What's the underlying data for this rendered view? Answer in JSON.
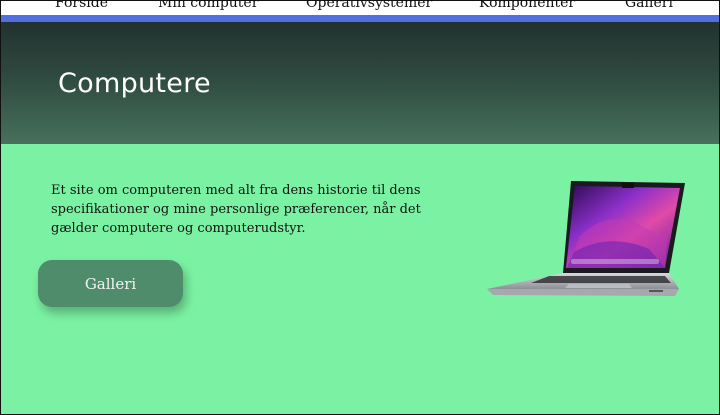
{
  "nav": {
    "items": [
      {
        "label": "Forside"
      },
      {
        "label": "Min computer"
      },
      {
        "label": "Operativsystemer"
      },
      {
        "label": "Komponenter"
      },
      {
        "label": "Galleri"
      }
    ]
  },
  "hero": {
    "title": "Computere"
  },
  "intro": {
    "text": "Et site om computeren med alt fra dens historie til dens specifikationer og mine personlige præferencer, når det gælder computere og computerudstyr."
  },
  "cta": {
    "label": "Galleri"
  },
  "colors": {
    "background": "#7bf2a3",
    "nav_accent": "#4f6fe3",
    "hero_dark": "#22312e",
    "hero_light": "#46705c",
    "button": "#4f8c6b"
  },
  "image": {
    "icon": "laptop-image"
  }
}
